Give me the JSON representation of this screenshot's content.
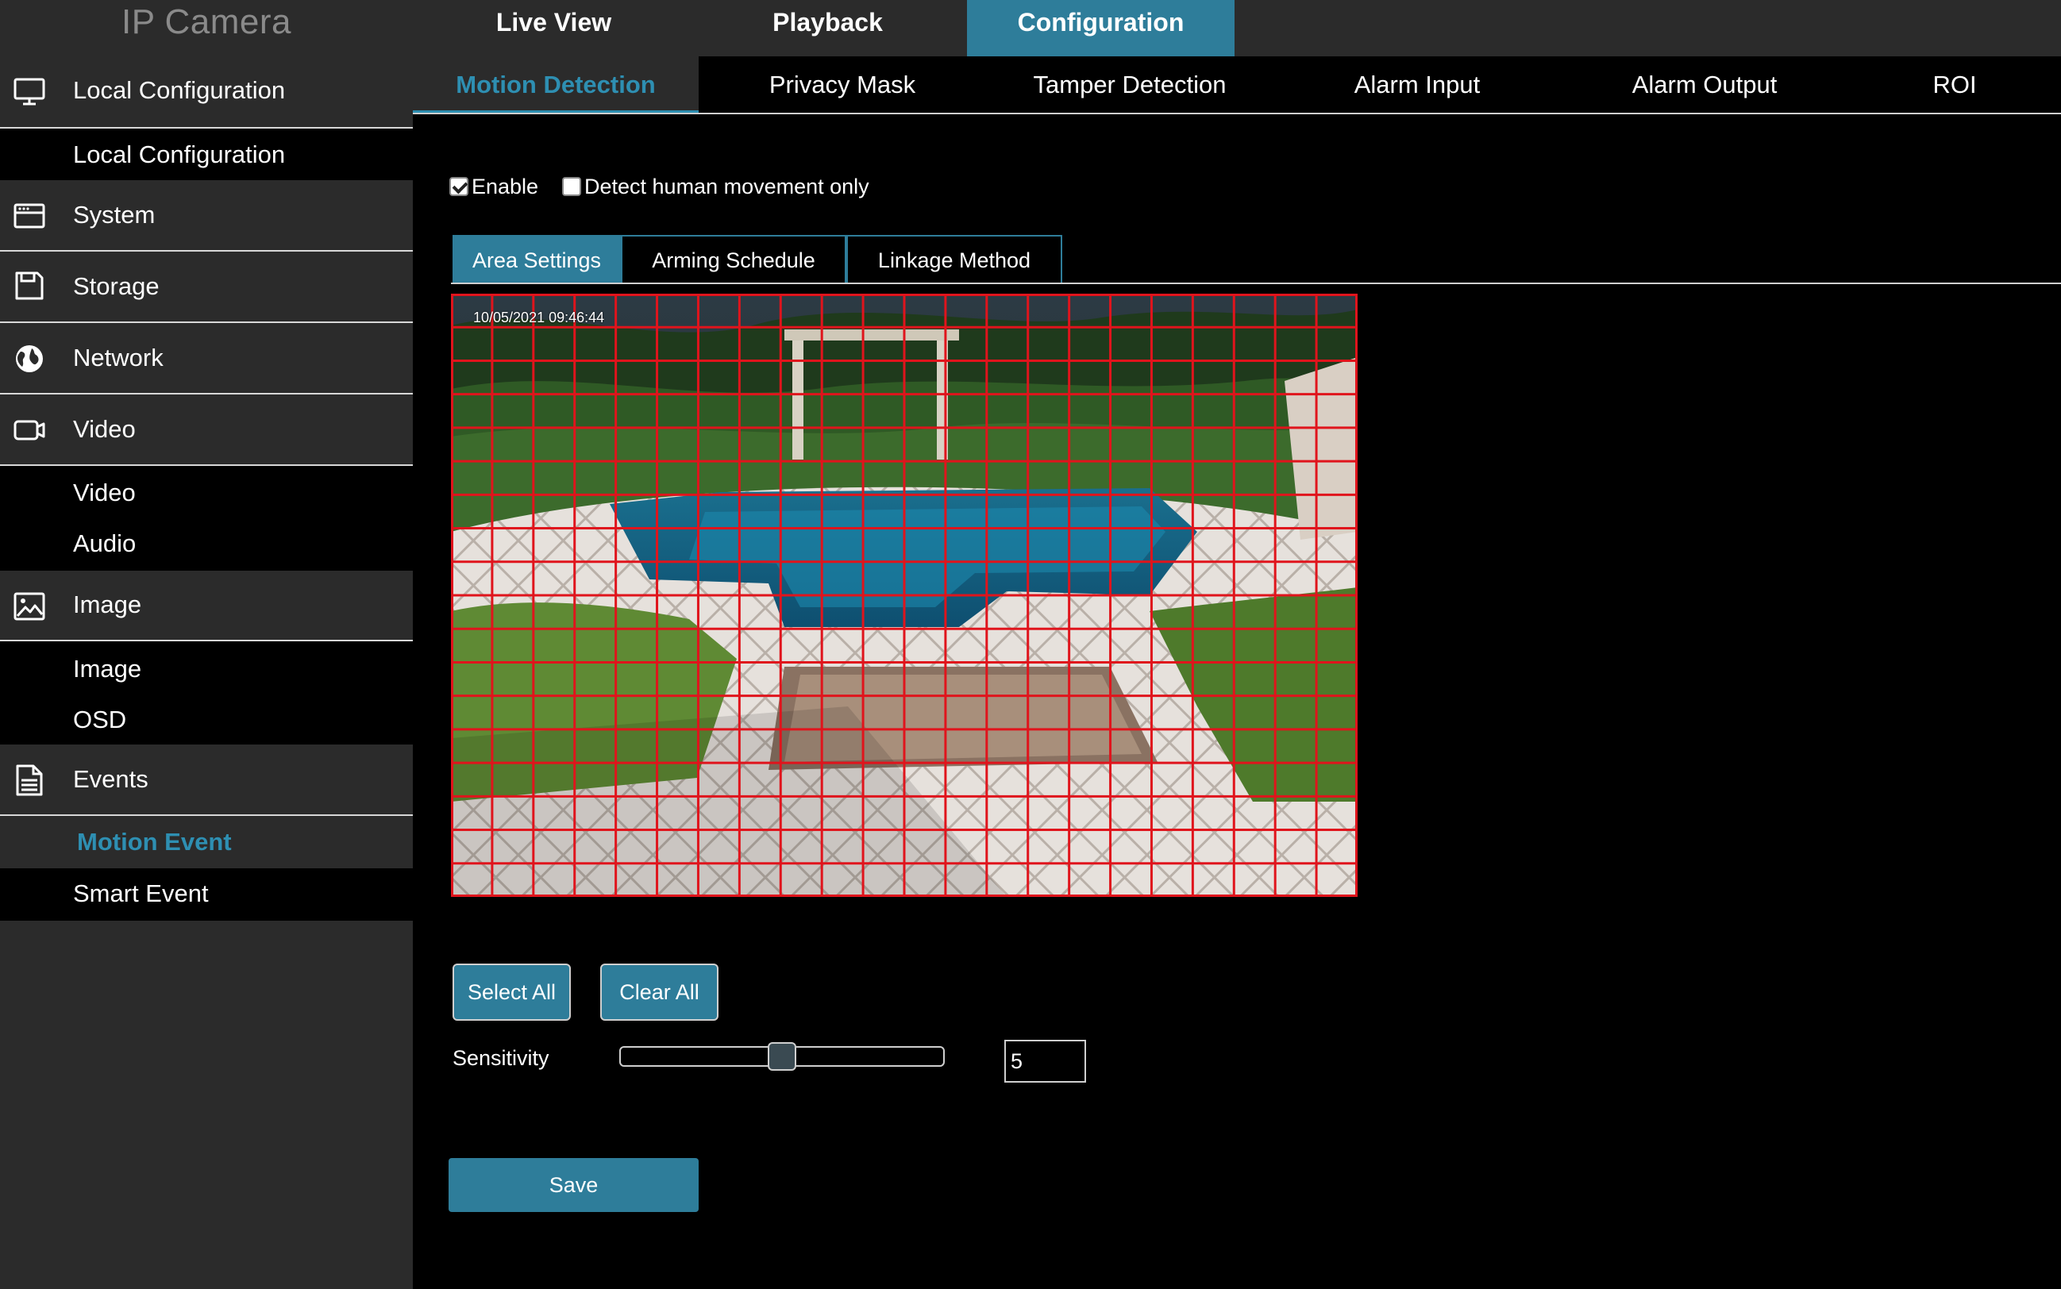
{
  "app": {
    "brand": "IP Camera"
  },
  "top_nav": {
    "tabs": [
      "Live View",
      "Playback",
      "Configuration"
    ],
    "active": "Configuration"
  },
  "sidebar": {
    "items": [
      {
        "type": "head",
        "label": "Local Configuration",
        "icon": "monitor-icon"
      },
      {
        "type": "sub",
        "label": "Local Configuration"
      },
      {
        "type": "head",
        "label": "System",
        "icon": "system-icon"
      },
      {
        "type": "head",
        "label": "Storage",
        "icon": "storage-icon"
      },
      {
        "type": "head",
        "label": "Network",
        "icon": "globe-icon"
      },
      {
        "type": "head",
        "label": "Video",
        "icon": "video-icon"
      },
      {
        "type": "sub",
        "label": "Video"
      },
      {
        "type": "sub",
        "label": "Audio"
      },
      {
        "type": "head",
        "label": "Image",
        "icon": "image-icon"
      },
      {
        "type": "sub",
        "label": "Image"
      },
      {
        "type": "sub",
        "label": "OSD"
      },
      {
        "type": "head",
        "label": "Events",
        "icon": "document-icon"
      },
      {
        "type": "sub",
        "label": "Motion Event",
        "active": true
      },
      {
        "type": "sub",
        "label": "Smart Event"
      }
    ]
  },
  "sub_nav": {
    "tabs": [
      "Motion Detection",
      "Privacy Mask",
      "Tamper Detection",
      "Alarm Input",
      "Alarm Output",
      "ROI"
    ],
    "active": "Motion Detection"
  },
  "options": {
    "enable_label": "Enable",
    "enable_checked": true,
    "human_label": "Detect human movement only",
    "human_checked": false
  },
  "inner_tabs": {
    "tabs": [
      "Area Settings",
      "Arming Schedule",
      "Linkage Method"
    ],
    "active": "Area Settings"
  },
  "video": {
    "timestamp": "10/05/2021  09:46:44",
    "grid_cols": 22,
    "grid_rows": 18,
    "grid_color": "#e0141c",
    "all_cells_selected": true
  },
  "buttons": {
    "select_all": "Select All",
    "clear_all": "Clear All",
    "save": "Save"
  },
  "sensitivity": {
    "label": "Sensitivity",
    "value": "5",
    "min": 0,
    "max": 10
  },
  "colors": {
    "accent": "#2e7d9a",
    "accent_text": "#2e8fb2",
    "sidebar_bg": "#2b2b2b"
  }
}
